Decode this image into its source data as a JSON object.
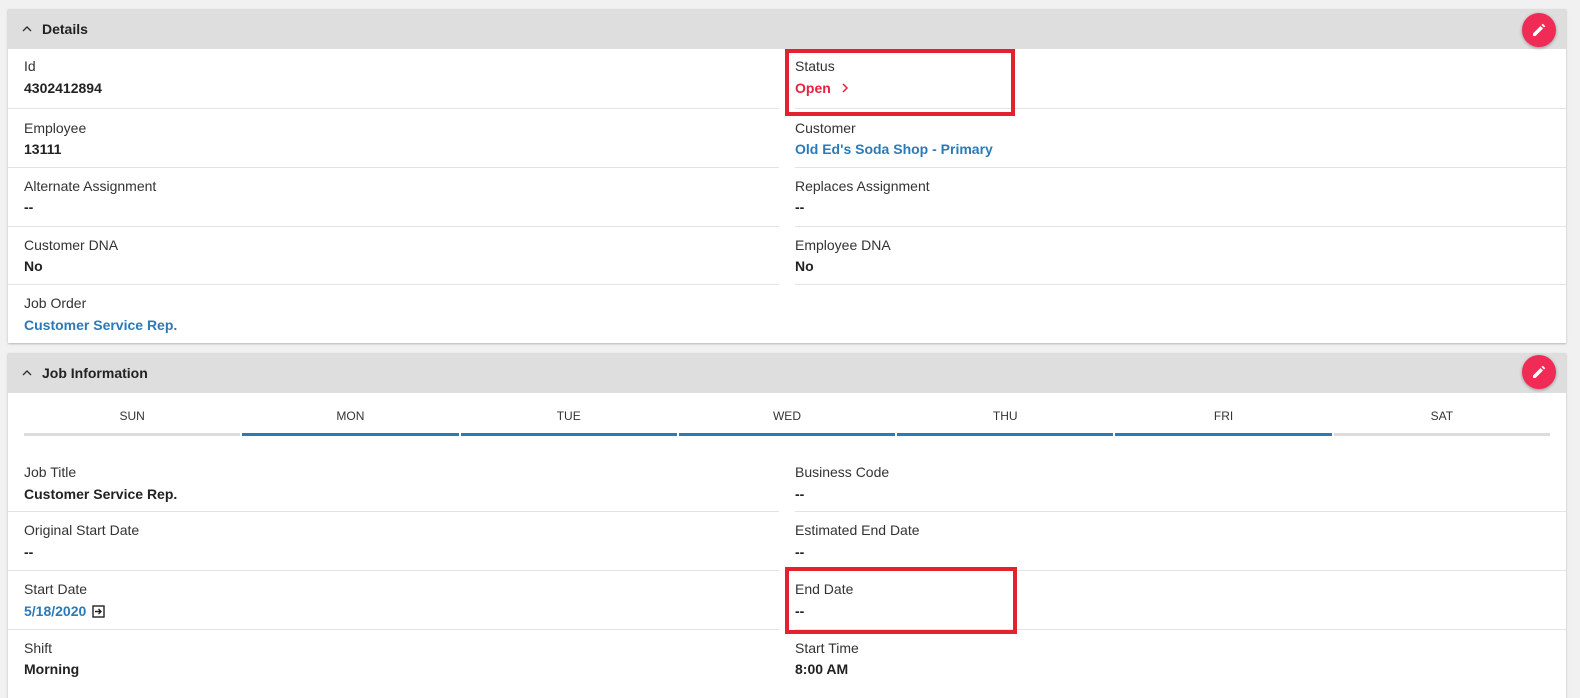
{
  "details": {
    "title": "Details",
    "rows": [
      [
        {
          "label": "Id",
          "value": "4302412894",
          "style": "plain"
        },
        {
          "label": "Status",
          "value": "Open",
          "style": "red"
        }
      ],
      [
        {
          "label": "Employee",
          "value": "13111",
          "style": "plain"
        },
        {
          "label": "Customer",
          "value": "Old Ed's Soda Shop - Primary",
          "style": "link"
        }
      ],
      [
        {
          "label": "Alternate Assignment",
          "value": "--",
          "style": "plain"
        },
        {
          "label": "Replaces Assignment",
          "value": "--",
          "style": "plain"
        }
      ],
      [
        {
          "label": "Customer DNA",
          "value": "No",
          "style": "plain"
        },
        {
          "label": "Employee DNA",
          "value": "No",
          "style": "plain"
        }
      ],
      [
        {
          "label": "Job Order",
          "value": "Customer Service Rep.",
          "style": "link"
        }
      ]
    ]
  },
  "job_information": {
    "title": "Job Information",
    "days": [
      {
        "label": "SUN",
        "active": false
      },
      {
        "label": "MON",
        "active": true
      },
      {
        "label": "TUE",
        "active": true
      },
      {
        "label": "WED",
        "active": true
      },
      {
        "label": "THU",
        "active": true
      },
      {
        "label": "FRI",
        "active": true
      },
      {
        "label": "SAT",
        "active": false
      }
    ],
    "rows": [
      [
        {
          "label": "Job Title",
          "value": "Customer Service Rep.",
          "style": "plain"
        },
        {
          "label": "Business Code",
          "value": "--",
          "style": "plain"
        }
      ],
      [
        {
          "label": "Original Start Date",
          "value": "--",
          "style": "plain"
        },
        {
          "label": "Estimated End Date",
          "value": "--",
          "style": "plain"
        }
      ],
      [
        {
          "label": "Start Date",
          "value": "5/18/2020",
          "style": "link"
        },
        {
          "label": "End Date",
          "value": "--",
          "style": "plain"
        }
      ],
      [
        {
          "label": "Shift",
          "value": "Morning",
          "style": "plain"
        },
        {
          "label": "Start Time",
          "value": "8:00 AM",
          "style": "plain"
        }
      ]
    ]
  },
  "colors": {
    "accent_blue": "#2a7ab8",
    "status_red": "#e8213f",
    "edit_button": "#f02b56",
    "highlight_box": "#e3222f"
  }
}
